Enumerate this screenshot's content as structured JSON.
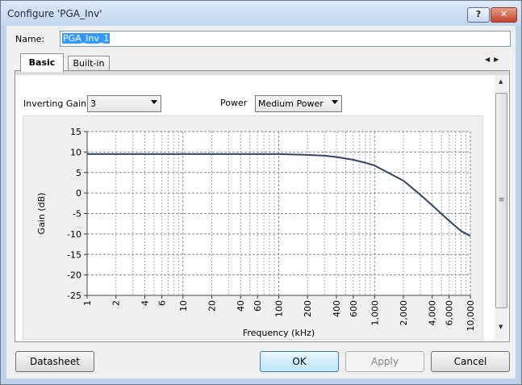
{
  "window": {
    "title": "Configure 'PGA_Inv'",
    "help_label": "?",
    "close_label": "✕"
  },
  "name": {
    "label": "Name:",
    "value": "PGA_Inv_1"
  },
  "tabs": [
    {
      "label": "Basic",
      "selected": true
    },
    {
      "label": "Built-in",
      "selected": false
    }
  ],
  "tab_scroll": {
    "left_icon": "◀",
    "right_icon": "▶"
  },
  "settings": {
    "gain_label": "Inverting Gain",
    "gain_value": "3",
    "power_label": "Power",
    "power_value": "Medium Power"
  },
  "scrollbar": {
    "up_icon": "▲",
    "down_icon": "▼",
    "grip": "≡"
  },
  "buttons": {
    "datasheet": "Datasheet",
    "ok": "OK",
    "apply": "Apply",
    "cancel": "Cancel"
  },
  "colors": {
    "curve": "#334466",
    "selection": "#3399ff"
  },
  "chart_data": {
    "type": "line",
    "xlabel": "Frequency (kHz)",
    "ylabel": "Gain (dB)",
    "x_scale": "log",
    "xlim": [
      1,
      10000
    ],
    "ylim": [
      -25,
      15
    ],
    "grid": true,
    "x_ticks": [
      1,
      2,
      4,
      6,
      10,
      20,
      40,
      60,
      100,
      200,
      400,
      600,
      1000,
      2000,
      4000,
      6000,
      10000
    ],
    "x_tick_labels": [
      "1",
      "2",
      "4",
      "6",
      "10",
      "20",
      "40",
      "60",
      "100",
      "200",
      "400",
      "600",
      "1,000",
      "2,000",
      "4,000",
      "6,000",
      "10,000"
    ],
    "y_ticks": [
      15,
      10,
      5,
      0,
      -5,
      -10,
      -15,
      -20,
      -25
    ],
    "y_tick_labels": [
      "15",
      "10",
      "5",
      "0",
      "-5",
      "-10",
      "-15",
      "-20",
      "-25"
    ],
    "series": [
      {
        "x": [
          1,
          10,
          100,
          200,
          300,
          400,
          600,
          800,
          1000,
          2000,
          3000,
          4000,
          6000,
          8000,
          10000
        ],
        "values": [
          9.5,
          9.5,
          9.5,
          9.3,
          9.1,
          8.8,
          8.1,
          7.4,
          6.7,
          3.0,
          -0.4,
          -3.0,
          -6.8,
          -9.3,
          -10.5
        ]
      }
    ]
  }
}
